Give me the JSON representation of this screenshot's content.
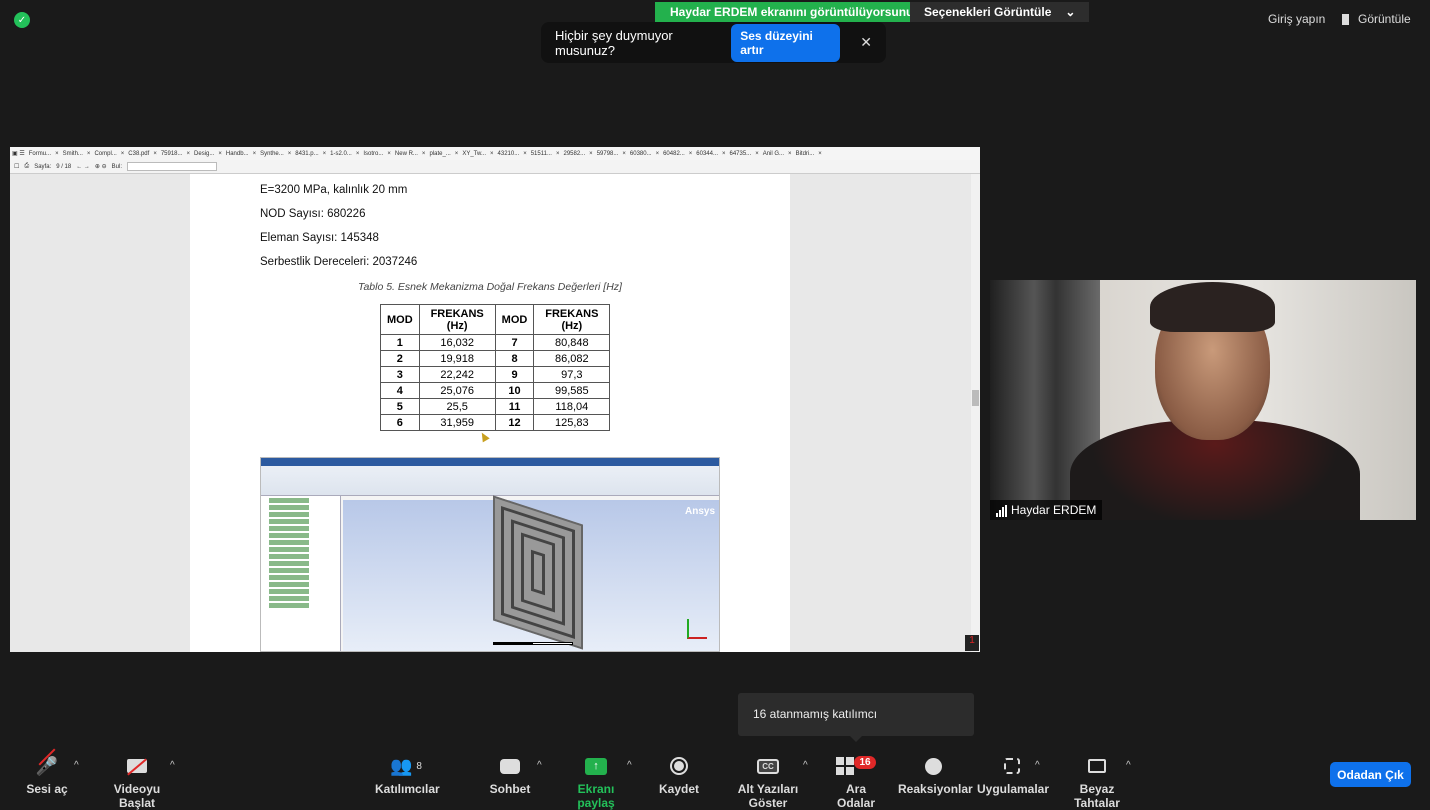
{
  "top": {
    "share_banner": "Haydar ERDEM ekranını görüntülüyorsunuz",
    "options_label": "Seçenekleri Görüntüle",
    "signin_label": "Giriş yapın",
    "view_label": "Görüntüle"
  },
  "audio_tip": {
    "message": "Hiçbir şey duymuyor musunuz?",
    "button": "Ses düzeyini artır"
  },
  "viewer": {
    "tabs": [
      "Formu...",
      "Smith...",
      "Compl...",
      "C38.pdf",
      "75918...",
      "Desig...",
      "Handb...",
      "Synthe...",
      "8431.p...",
      "1-s2.0...",
      "Isotro...",
      "New R...",
      "plate_...",
      "XY_Tw...",
      "43210...",
      "51511...",
      "29582...",
      "59798...",
      "60380...",
      "60482...",
      "60344...",
      "64735...",
      "Anil G...",
      "Bitdri..."
    ],
    "page_label": "Sayfa:",
    "page_value": "9 / 18",
    "find_label": "Bul:"
  },
  "document": {
    "lines": [
      "E=3200 MPa, kalınlık 20 mm",
      "NOD Sayısı: 680226",
      "Eleman Sayısı: 145348",
      "Serbestlik Dereceleri: 2037246"
    ],
    "caption": "Tablo 5. Esnek Mekanizma Doğal Frekans Değerleri [Hz]",
    "table": {
      "headers": [
        "MOD",
        "FREKANS (Hz)",
        "MOD",
        "FREKANS (Hz)"
      ],
      "rows": [
        [
          "1",
          "16,032",
          "7",
          "80,848"
        ],
        [
          "2",
          "19,918",
          "8",
          "86,082"
        ],
        [
          "3",
          "22,242",
          "9",
          "97,3"
        ],
        [
          "4",
          "25,076",
          "10",
          "99,585"
        ],
        [
          "5",
          "25,5",
          "11",
          "118,04"
        ],
        [
          "6",
          "31,959",
          "12",
          "125,83"
        ]
      ]
    },
    "ansys_brand": "Ansys"
  },
  "video": {
    "participant_name": "Haydar ERDEM"
  },
  "tooltip": {
    "unassigned": "16 atanmamış katılımcı"
  },
  "toolbar": {
    "unmute": "Sesi aç",
    "start_video": "Videoyu Başlat",
    "participants": "Katılımcılar",
    "participants_count": "8",
    "chat": "Sohbet",
    "share_screen": "Ekranı paylaş",
    "record": "Kaydet",
    "captions": "Alt Yazıları Göster",
    "captions_icon": "CC",
    "breakout": "Ara Odalar",
    "breakout_badge": "16",
    "reactions": "Reaksiyonlar",
    "apps": "Uygulamalar",
    "whiteboard": "Beyaz Tahtalar",
    "leave_room": "Odadan Çık"
  },
  "colors": {
    "share_green": "#23b14d",
    "accent_blue": "#0e71eb",
    "badge_red": "#e02828"
  }
}
